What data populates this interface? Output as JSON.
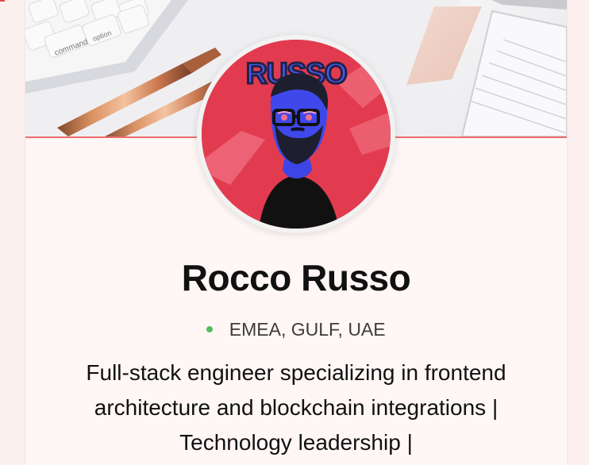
{
  "profile": {
    "name": "Rocco Russo",
    "location": "EMEA, GULF, UAE",
    "bio": "Full-stack engineer specializing in frontend architecture and blockchain integrations | Technology leadership |",
    "avatar_text": "RUSSO"
  },
  "banner": {
    "keyboard_keys": [
      "command",
      "option"
    ]
  },
  "colors": {
    "page_bg": "#fbf0ee",
    "card_bg": "#fff7f6",
    "accent_line": "#ef6d6d",
    "online_status": "#53c05b",
    "avatar_bg": "#e23b4f"
  },
  "icons": {
    "status": "online-status-dot"
  }
}
